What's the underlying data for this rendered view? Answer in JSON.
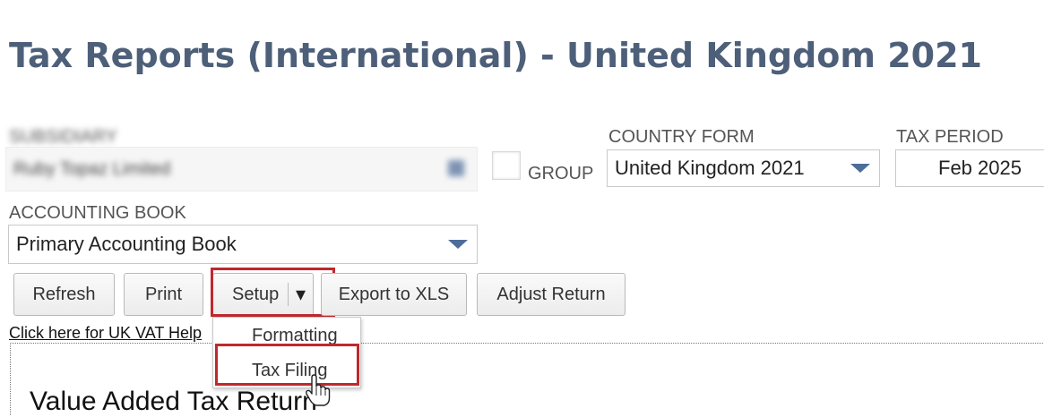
{
  "page": {
    "title": "Tax Reports (International) - United Kingdom 2021"
  },
  "filters": {
    "subsidiary_label": "SUBSIDIARY",
    "subsidiary_value": "Ruby Topaz Limited",
    "group_label": "GROUP",
    "country_form_label": "COUNTRY FORM",
    "country_form_value": "United Kingdom 2021",
    "tax_period_label": "TAX PERIOD",
    "tax_period_value": "Feb 2025",
    "accounting_book_label": "ACCOUNTING BOOK",
    "accounting_book_value": "Primary Accounting Book"
  },
  "toolbar": {
    "refresh_label": "Refresh",
    "print_label": "Print",
    "setup_label": "Setup",
    "setup_arrow": "▾",
    "export_label": "Export to XLS",
    "adjust_label": "Adjust Return"
  },
  "setup_menu": {
    "items": [
      {
        "label": "Formatting"
      },
      {
        "label": "Tax Filing"
      }
    ]
  },
  "help_link": "Click here for UK VAT Help",
  "report": {
    "heading": "Value Added Tax Return"
  },
  "colors": {
    "title": "#4d5f79",
    "highlight": "#c0282d",
    "dropdown_arrow": "#4d6d9a"
  }
}
